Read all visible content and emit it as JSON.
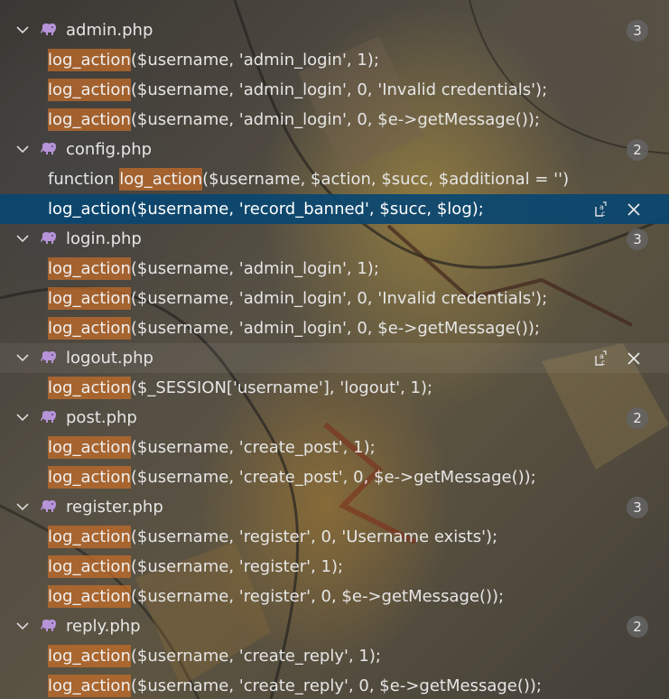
{
  "files": [
    {
      "name": "admin.php",
      "count": "3",
      "icon": "php-elephant-icon",
      "matches": [
        {
          "hl": "log_action",
          "rest": "($username, 'admin_login', 1);"
        },
        {
          "hl": "log_action",
          "rest": "($username, 'admin_login', 0, 'Invalid credentials');"
        },
        {
          "hl": "log_action",
          "rest": "($username, 'admin_login', 0, $e->getMessage());"
        }
      ]
    },
    {
      "name": "config.php",
      "count": "2",
      "icon": "php-elephant-icon",
      "matches": [
        {
          "pre": "function ",
          "hl": "log_action",
          "rest": "($username, $action, $succ, $additional = '')"
        },
        {
          "hl": "log_action",
          "rest": "($username, 'record_banned', $succ, $log);",
          "selected": true
        }
      ]
    },
    {
      "name": "login.php",
      "count": "3",
      "icon": "php-elephant-icon",
      "matches": [
        {
          "hl": "log_action",
          "rest": "($username, 'admin_login', 1);"
        },
        {
          "hl": "log_action",
          "rest": "($username, 'admin_login', 0, 'Invalid credentials');"
        },
        {
          "hl": "log_action",
          "rest": "($username, 'admin_login', 0, $e->getMessage());"
        }
      ]
    },
    {
      "name": "logout.php",
      "count": "",
      "icon": "php-elephant-icon",
      "hover": true,
      "matches": [
        {
          "hl": "log_action",
          "rest": "($_SESSION['username'], 'logout', 1);"
        }
      ]
    },
    {
      "name": "post.php",
      "count": "2",
      "icon": "php-elephant-icon",
      "matches": [
        {
          "hl": "log_action",
          "rest": "($username, 'create_post', 1);"
        },
        {
          "hl": "log_action",
          "rest": "($username, 'create_post', 0, $e->getMessage());"
        }
      ]
    },
    {
      "name": "register.php",
      "count": "3",
      "icon": "php-elephant-icon",
      "matches": [
        {
          "hl": "log_action",
          "rest": "($username, 'register', 0, 'Username exists');"
        },
        {
          "hl": "log_action",
          "rest": "($username, 'register', 1);"
        },
        {
          "hl": "log_action",
          "rest": "($username, 'register', 0, $e->getMessage());"
        }
      ]
    },
    {
      "name": "reply.php",
      "count": "2",
      "icon": "php-elephant-icon",
      "matches": [
        {
          "hl": "log_action",
          "rest": "($username, 'create_reply', 1);"
        },
        {
          "hl": "log_action",
          "rest": "($username, 'create_reply', 0, $e->getMessage());"
        }
      ]
    }
  ],
  "colors": {
    "highlight": "#c86e28",
    "selection": "#094771",
    "text": "#e6e6e6",
    "badge_bg": "#646464"
  },
  "icons": {
    "replace": "replace-icon",
    "dismiss": "close-icon",
    "expand": "chevron-down-icon"
  }
}
